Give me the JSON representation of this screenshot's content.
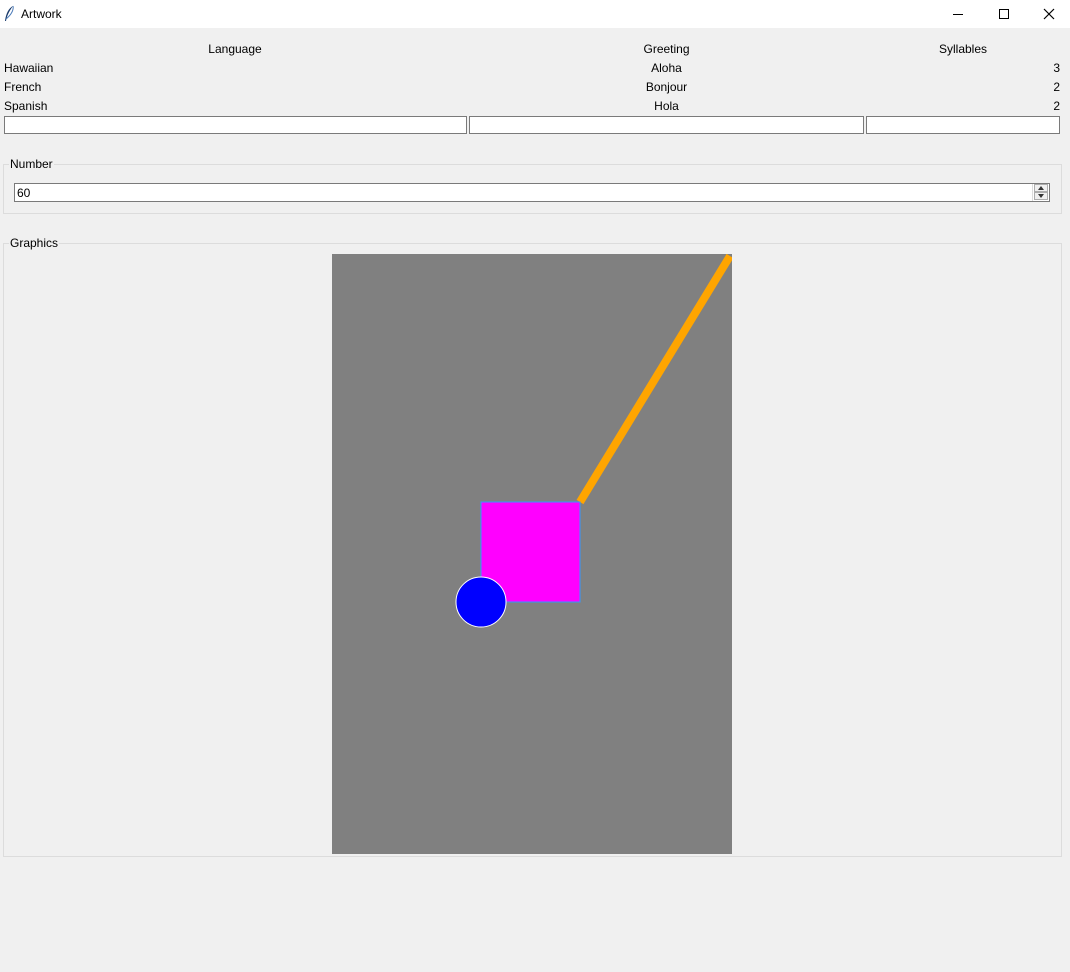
{
  "window": {
    "title": "Artwork"
  },
  "table": {
    "headers": [
      "Language",
      "Greeting",
      "Syllables"
    ],
    "rows": [
      {
        "language": "Hawaiian",
        "greeting": "Aloha",
        "syllables": "3"
      },
      {
        "language": "French",
        "greeting": "Bonjour",
        "syllables": "2"
      },
      {
        "language": "Spanish",
        "greeting": "Hola",
        "syllables": "2"
      }
    ],
    "entries": {
      "language": "",
      "greeting": "",
      "syllables": ""
    }
  },
  "number_frame": {
    "title": "Number",
    "value": "60"
  },
  "graphics_frame": {
    "title": "Graphics",
    "canvas_color": "#808080",
    "line_color": "#ffa500",
    "square_fill": "#ff00ff",
    "square_outline": "#3399ff",
    "circle_fill": "#0000ff",
    "circle_outline": "#ffffff"
  }
}
